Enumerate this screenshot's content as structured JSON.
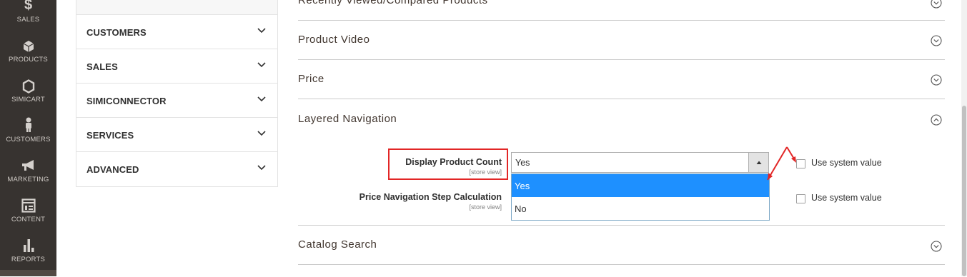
{
  "nav": {
    "items": [
      {
        "label": "SALES",
        "icon": "dollar-icon"
      },
      {
        "label": "PRODUCTS",
        "icon": "cube-icon"
      },
      {
        "label": "SIMICART",
        "icon": "hexagon-icon"
      },
      {
        "label": "CUSTOMERS",
        "icon": "person-icon"
      },
      {
        "label": "MARKETING",
        "icon": "megaphone-icon"
      },
      {
        "label": "CONTENT",
        "icon": "layout-icon"
      },
      {
        "label": "REPORTS",
        "icon": "bar-chart-icon"
      }
    ]
  },
  "sidebar": {
    "items": [
      {
        "label": "CUSTOMERS"
      },
      {
        "label": "SALES"
      },
      {
        "label": "SIMICONNECTOR"
      },
      {
        "label": "SERVICES"
      },
      {
        "label": "ADVANCED"
      }
    ]
  },
  "sections": {
    "recently_viewed": "Recently Viewed/Compared Products",
    "product_video": "Product Video",
    "price": "Price",
    "layered_navigation": "Layered Navigation",
    "catalog_search": "Catalog Search"
  },
  "layered": {
    "display_product_count": {
      "label": "Display Product Count",
      "scope": "[store view]",
      "value": "Yes",
      "options": [
        "Yes",
        "No"
      ],
      "use_system_value": "Use system value"
    },
    "price_step": {
      "label": "Price Navigation Step Calculation",
      "scope": "[store view]",
      "use_system_value": "Use system value"
    }
  },
  "colors": {
    "nav_bg": "#373330",
    "highlight": "#e22626",
    "option_selected": "#1e90ff"
  }
}
